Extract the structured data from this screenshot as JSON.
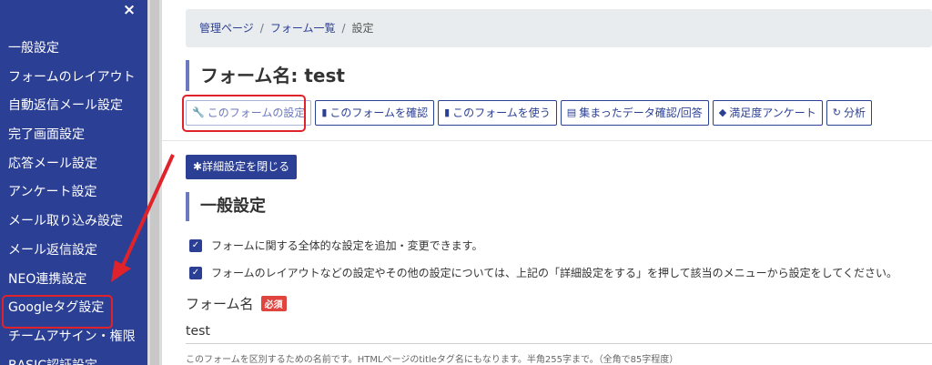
{
  "sidebar": {
    "close_label": "×",
    "items": [
      {
        "label": "一般設定"
      },
      {
        "label": "フォームのレイアウト"
      },
      {
        "label": "自動返信メール設定"
      },
      {
        "label": "完了画面設定"
      },
      {
        "label": "応答メール設定"
      },
      {
        "label": "アンケート設定"
      },
      {
        "label": "メール取り込み設定"
      },
      {
        "label": "メール返信設定"
      },
      {
        "label": "NEO連携設定"
      },
      {
        "label": "Googleタグ設定"
      },
      {
        "label": "チームアサイン・権限"
      },
      {
        "label": "BASIC認証設定"
      }
    ]
  },
  "breadcrumb": {
    "items": [
      "管理ページ",
      "フォーム一覧",
      "設定"
    ],
    "separator": "/"
  },
  "page_title": "フォーム名: test",
  "actions": [
    {
      "icon": "wrench-icon",
      "glyph": "🔧",
      "label": "このフォームの設定"
    },
    {
      "icon": "document-icon",
      "glyph": "▮",
      "label": "このフォームを確認"
    },
    {
      "icon": "document-icon",
      "glyph": "▮",
      "label": "このフォームを使う"
    },
    {
      "icon": "list-icon",
      "glyph": "▤",
      "label": "集まったデータ確認/回答"
    },
    {
      "icon": "layers-icon",
      "glyph": "◆",
      "label": "満足度アンケート"
    },
    {
      "icon": "refresh-icon",
      "glyph": "↻",
      "label": "分析"
    }
  ],
  "detail_button": {
    "icon": "gear-icon",
    "glyph": "✱",
    "label": "詳細設定を閉じる"
  },
  "section_title": "一般設定",
  "checks": [
    {
      "label": "フォームに関する全体的な設定を追加・変更できます。"
    },
    {
      "label": "フォームのレイアウトなどの設定やその他の設定については、上記の「詳細設定をする」を押して該当のメニューから設定をしてください。"
    }
  ],
  "form_name_field": {
    "label": "フォーム名",
    "badge": "必須",
    "value": "test",
    "help": "このフォームを区別するための名前です。HTMLページのtitleタグ名にもなります。半角255字まで。（全角で85字程度）"
  },
  "colors": {
    "sidebar_bg": "#2b3f94",
    "accent": "#2b3f94",
    "highlight": "#e0232b"
  }
}
